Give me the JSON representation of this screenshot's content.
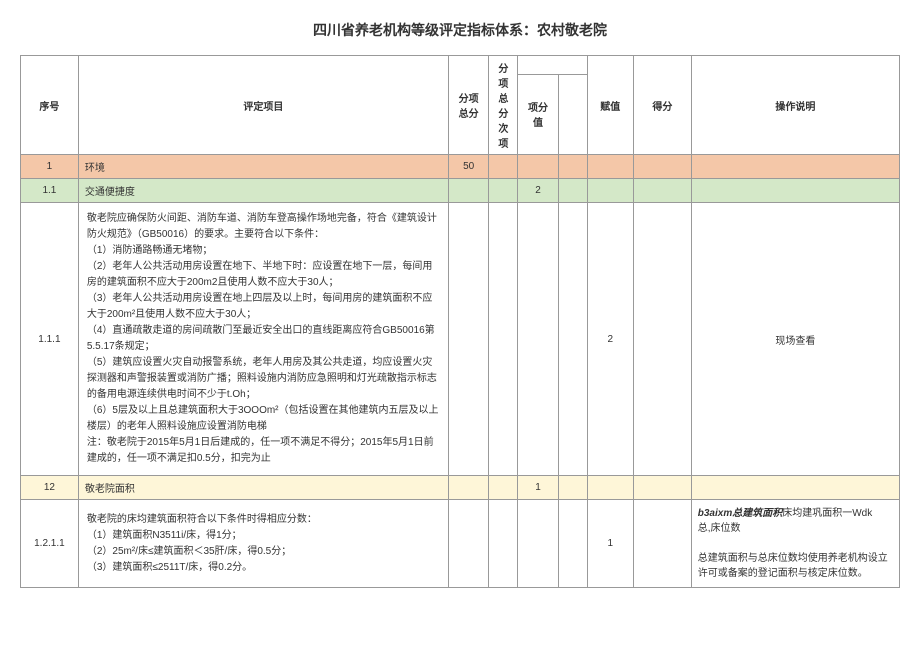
{
  "title": "四川省养老机构等级评定指标体系：农村敬老院",
  "headers": {
    "seq": "序号",
    "item": "评定项目",
    "subtotal": "分项总分",
    "subc": "分项总分次项",
    "subv": "项分值",
    "fz": "赋值",
    "score": "得分",
    "op": "操作说明"
  },
  "rows": {
    "env": {
      "seq": "1",
      "item": "环境",
      "subtotal": "50"
    },
    "traffic": {
      "seq": "1.1",
      "item": "交通便捷度",
      "subv": "2"
    },
    "r111": {
      "seq": "1.1.1",
      "detail": "敬老院应确保防火间距、消防车道、消防车登高操作场地完备，符合《建筑设计防火规范》（GB50016）的要求。主要符合以下条件：\n（1）消防通路畅通无堵物；\n（2）老年人公共活动用房设置在地下、半地下时：应设置在地下一层，每间用房的建筑面积不应大于200m2且使用人数不应大于30人；\n（3）老年人公共活动用房设置在地上四层及以上时，每间用房的建筑面积不应大于200m²且使用人数不应大于30人；\n（4）直通疏散走道的房间疏散门至最近安全出口的直线距离应符合GB50016第5.5.17条规定；\n（5）建筑应设置火灾自动报警系统，老年人用房及其公共走道，均应设置火灾探测器和声警报装置或消防广播；照料设施内消防应急照明和灯光疏散指示标志的备用电源连续供电时间不少于t.Oh；\n（6）5层及以上且总建筑面积大于3OOOm²（包括设置在其他建筑内五层及以上楼层）的老年人照料设施应设置消防电梯\n注：敬老院于2015年5月1日后建成的，任一项不满足不得分；2015年5月1日前建成的，任一项不满足扣0.5分，扣完为止",
      "fz": "2",
      "op": "现场查看"
    },
    "area": {
      "seq": "12",
      "item": "敬老院面积",
      "subv": "1"
    },
    "r1211": {
      "seq": "1.2.1.1",
      "detail": "敬老院的床均建筑面积符合以下条件时得相应分数：\n（1）建筑面积N3511i/床，得1分；\n（2）25m²/床≤建筑面积＜35肝/床，得0.5分；\n（3）建筑面积≤2511T/床，得0.2分。",
      "fz": "1",
      "op1": "b3aixm总建筑面积",
      "op2": "床均建巩面积一Wdk",
      "op3": "总,床位数",
      "op4": "总建筑面积与总床位数均使用养老机构设立许可或备案的登记面积与核定床位数。"
    }
  }
}
